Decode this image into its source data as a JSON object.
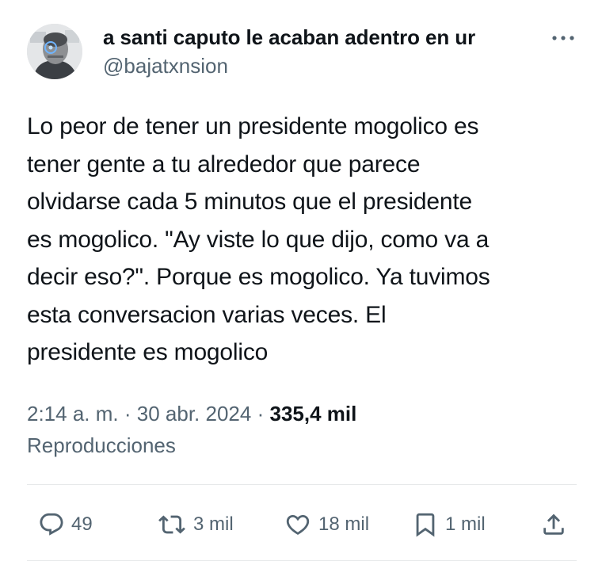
{
  "tweet": {
    "display_name": "a santi caputo le acaban adentro en ur",
    "handle": "@bajatxnsion",
    "text": "Lo peor de tener un presidente mogolico es\ntener gente a tu alrededor que parece\nolvidarse cada 5 minutos que el presidente\nes mogolico. \"Ay viste lo que dijo, como va a\ndecir eso?\". Porque es mogolico. Ya tuvimos\nesta conversacion varias veces. El\npresidente es mogolico",
    "time": "2:14 a. m.",
    "separator": "·",
    "date": "30 abr. 2024",
    "views": "335,4 mil",
    "views_label": "Reproducciones"
  },
  "actions": {
    "replies": "49",
    "reposts": "3 mil",
    "likes": "18 mil",
    "bookmarks": "1 mil"
  },
  "icons": {
    "more": "more-icon",
    "reply": "reply-icon",
    "repost": "repost-icon",
    "like": "heart-icon",
    "bookmark": "bookmark-icon",
    "share": "share-icon"
  },
  "colors": {
    "text": "#0f1419",
    "secondary": "#536471",
    "divider": "#e7e9ea"
  }
}
